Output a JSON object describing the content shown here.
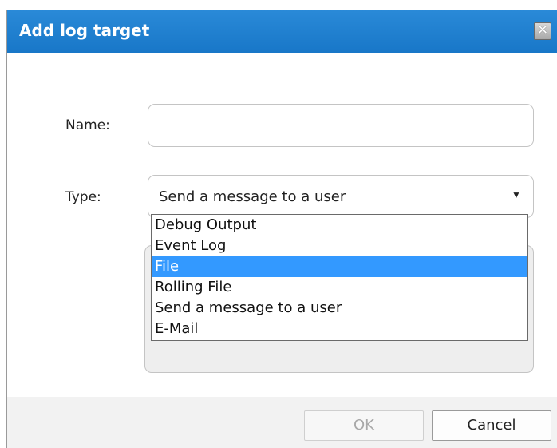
{
  "dialog": {
    "title": "Add log target",
    "close_label": "✕"
  },
  "form": {
    "name_label": "Name:",
    "name_value": "",
    "type_label": "Type:",
    "type_value": "Send a message to a user",
    "type_options": [
      "Debug Output",
      "Event Log",
      "File",
      "Rolling File",
      "Send a message to a user",
      "E-Mail"
    ],
    "highlighted_option": "File"
  },
  "footer": {
    "ok_label": "OK",
    "cancel_label": "Cancel"
  },
  "colors": {
    "titlebar": "#1877c8",
    "highlight": "#3399ff"
  }
}
